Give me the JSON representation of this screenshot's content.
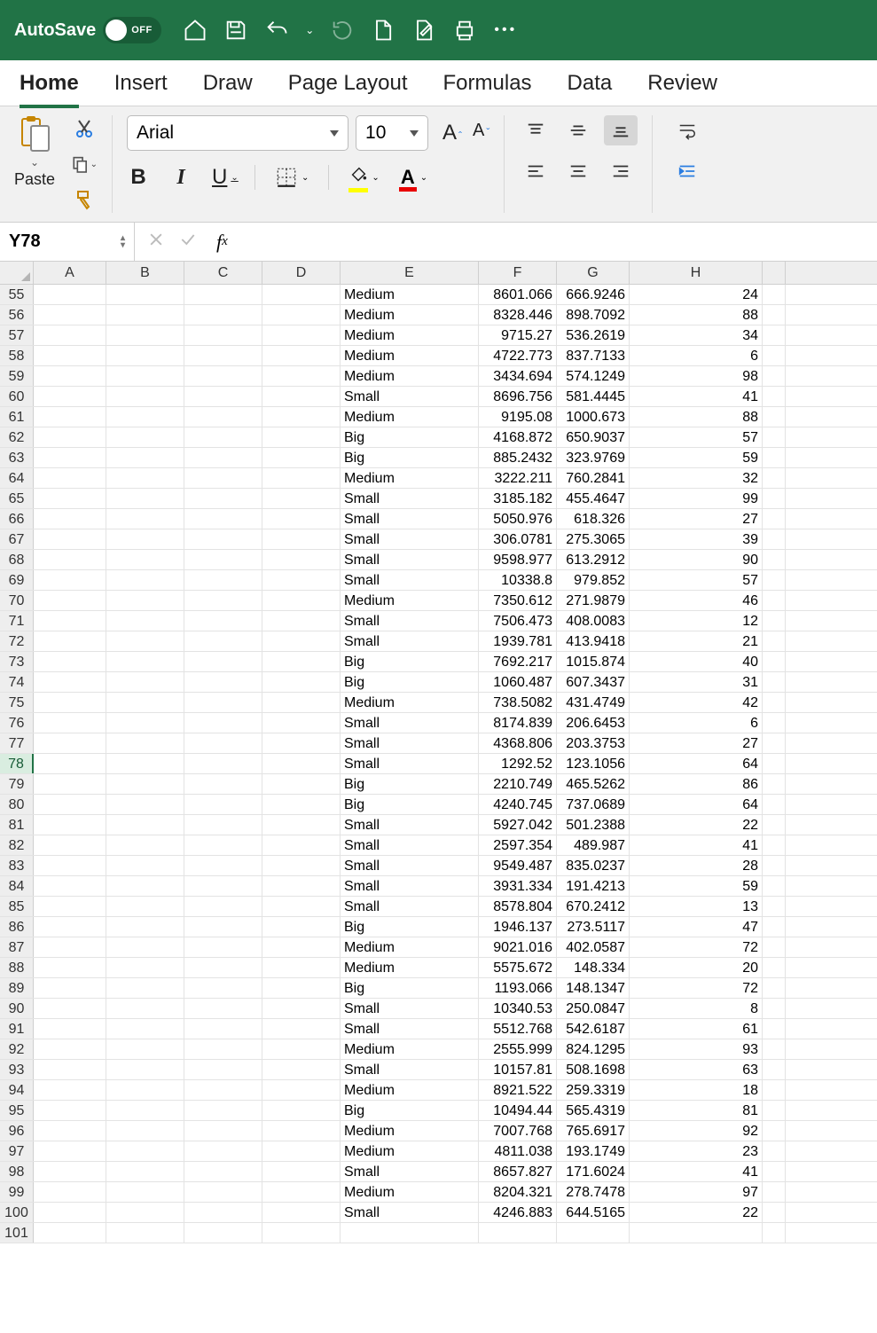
{
  "titlebar": {
    "autosave_label": "AutoSave",
    "autosave_state": "OFF"
  },
  "ribbon": {
    "tabs": [
      "Home",
      "Insert",
      "Draw",
      "Page Layout",
      "Formulas",
      "Data",
      "Review"
    ],
    "active_tab": "Home",
    "paste_label": "Paste",
    "font_name": "Arial",
    "font_size": "10"
  },
  "name_box": "Y78",
  "formula_value": "",
  "columns": [
    "A",
    "B",
    "C",
    "D",
    "E",
    "F",
    "G",
    "H"
  ],
  "col_classes": [
    "cA",
    "cB",
    "cC",
    "cD",
    "cE",
    "cF",
    "cG",
    "cH"
  ],
  "active_row": 78,
  "rows": [
    {
      "n": 55,
      "e": "Medium",
      "f": "8601.066",
      "g": "666.9246",
      "h": "24"
    },
    {
      "n": 56,
      "e": "Medium",
      "f": "8328.446",
      "g": "898.7092",
      "h": "88"
    },
    {
      "n": 57,
      "e": "Medium",
      "f": "9715.27",
      "g": "536.2619",
      "h": "34"
    },
    {
      "n": 58,
      "e": "Medium",
      "f": "4722.773",
      "g": "837.7133",
      "h": "6"
    },
    {
      "n": 59,
      "e": "Medium",
      "f": "3434.694",
      "g": "574.1249",
      "h": "98"
    },
    {
      "n": 60,
      "e": "Small",
      "f": "8696.756",
      "g": "581.4445",
      "h": "41"
    },
    {
      "n": 61,
      "e": "Medium",
      "f": "9195.08",
      "g": "1000.673",
      "h": "88"
    },
    {
      "n": 62,
      "e": "Big",
      "f": "4168.872",
      "g": "650.9037",
      "h": "57"
    },
    {
      "n": 63,
      "e": "Big",
      "f": "885.2432",
      "g": "323.9769",
      "h": "59"
    },
    {
      "n": 64,
      "e": "Medium",
      "f": "3222.211",
      "g": "760.2841",
      "h": "32"
    },
    {
      "n": 65,
      "e": "Small",
      "f": "3185.182",
      "g": "455.4647",
      "h": "99"
    },
    {
      "n": 66,
      "e": "Small",
      "f": "5050.976",
      "g": "618.326",
      "h": "27"
    },
    {
      "n": 67,
      "e": "Small",
      "f": "306.0781",
      "g": "275.3065",
      "h": "39"
    },
    {
      "n": 68,
      "e": "Small",
      "f": "9598.977",
      "g": "613.2912",
      "h": "90"
    },
    {
      "n": 69,
      "e": "Small",
      "f": "10338.8",
      "g": "979.852",
      "h": "57"
    },
    {
      "n": 70,
      "e": "Medium",
      "f": "7350.612",
      "g": "271.9879",
      "h": "46"
    },
    {
      "n": 71,
      "e": "Small",
      "f": "7506.473",
      "g": "408.0083",
      "h": "12"
    },
    {
      "n": 72,
      "e": "Small",
      "f": "1939.781",
      "g": "413.9418",
      "h": "21"
    },
    {
      "n": 73,
      "e": "Big",
      "f": "7692.217",
      "g": "1015.874",
      "h": "40"
    },
    {
      "n": 74,
      "e": "Big",
      "f": "1060.487",
      "g": "607.3437",
      "h": "31"
    },
    {
      "n": 75,
      "e": "Medium",
      "f": "738.5082",
      "g": "431.4749",
      "h": "42"
    },
    {
      "n": 76,
      "e": "Small",
      "f": "8174.839",
      "g": "206.6453",
      "h": "6"
    },
    {
      "n": 77,
      "e": "Small",
      "f": "4368.806",
      "g": "203.3753",
      "h": "27"
    },
    {
      "n": 78,
      "e": "Small",
      "f": "1292.52",
      "g": "123.1056",
      "h": "64"
    },
    {
      "n": 79,
      "e": "Big",
      "f": "2210.749",
      "g": "465.5262",
      "h": "86"
    },
    {
      "n": 80,
      "e": "Big",
      "f": "4240.745",
      "g": "737.0689",
      "h": "64"
    },
    {
      "n": 81,
      "e": "Small",
      "f": "5927.042",
      "g": "501.2388",
      "h": "22"
    },
    {
      "n": 82,
      "e": "Small",
      "f": "2597.354",
      "g": "489.987",
      "h": "41"
    },
    {
      "n": 83,
      "e": "Small",
      "f": "9549.487",
      "g": "835.0237",
      "h": "28"
    },
    {
      "n": 84,
      "e": "Small",
      "f": "3931.334",
      "g": "191.4213",
      "h": "59"
    },
    {
      "n": 85,
      "e": "Small",
      "f": "8578.804",
      "g": "670.2412",
      "h": "13"
    },
    {
      "n": 86,
      "e": "Big",
      "f": "1946.137",
      "g": "273.5117",
      "h": "47"
    },
    {
      "n": 87,
      "e": "Medium",
      "f": "9021.016",
      "g": "402.0587",
      "h": "72"
    },
    {
      "n": 88,
      "e": "Medium",
      "f": "5575.672",
      "g": "148.334",
      "h": "20"
    },
    {
      "n": 89,
      "e": "Big",
      "f": "1193.066",
      "g": "148.1347",
      "h": "72"
    },
    {
      "n": 90,
      "e": "Small",
      "f": "10340.53",
      "g": "250.0847",
      "h": "8"
    },
    {
      "n": 91,
      "e": "Small",
      "f": "5512.768",
      "g": "542.6187",
      "h": "61"
    },
    {
      "n": 92,
      "e": "Medium",
      "f": "2555.999",
      "g": "824.1295",
      "h": "93"
    },
    {
      "n": 93,
      "e": "Small",
      "f": "10157.81",
      "g": "508.1698",
      "h": "63"
    },
    {
      "n": 94,
      "e": "Medium",
      "f": "8921.522",
      "g": "259.3319",
      "h": "18"
    },
    {
      "n": 95,
      "e": "Big",
      "f": "10494.44",
      "g": "565.4319",
      "h": "81"
    },
    {
      "n": 96,
      "e": "Medium",
      "f": "7007.768",
      "g": "765.6917",
      "h": "92"
    },
    {
      "n": 97,
      "e": "Medium",
      "f": "4811.038",
      "g": "193.1749",
      "h": "23"
    },
    {
      "n": 98,
      "e": "Small",
      "f": "8657.827",
      "g": "171.6024",
      "h": "41"
    },
    {
      "n": 99,
      "e": "Medium",
      "f": "8204.321",
      "g": "278.7478",
      "h": "97"
    },
    {
      "n": 100,
      "e": "Small",
      "f": "4246.883",
      "g": "644.5165",
      "h": "22"
    },
    {
      "n": 101,
      "e": "",
      "f": "",
      "g": "",
      "h": ""
    }
  ]
}
